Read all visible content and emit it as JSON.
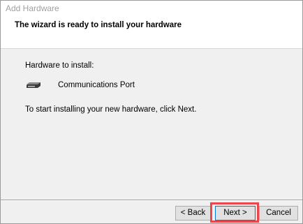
{
  "window": {
    "title": "Add Hardware"
  },
  "header": {
    "title": "The wizard is ready to install your hardware"
  },
  "content": {
    "hardware_label": "Hardware to install:",
    "device_name": "Communications Port",
    "device_icon": "port-device-icon",
    "instruction": "To start installing your new hardware, click Next."
  },
  "buttons": {
    "back": "< Back",
    "next": "Next >",
    "cancel": "Cancel"
  },
  "colors": {
    "highlight": "#e8474c",
    "focus_border": "#0078d7"
  }
}
